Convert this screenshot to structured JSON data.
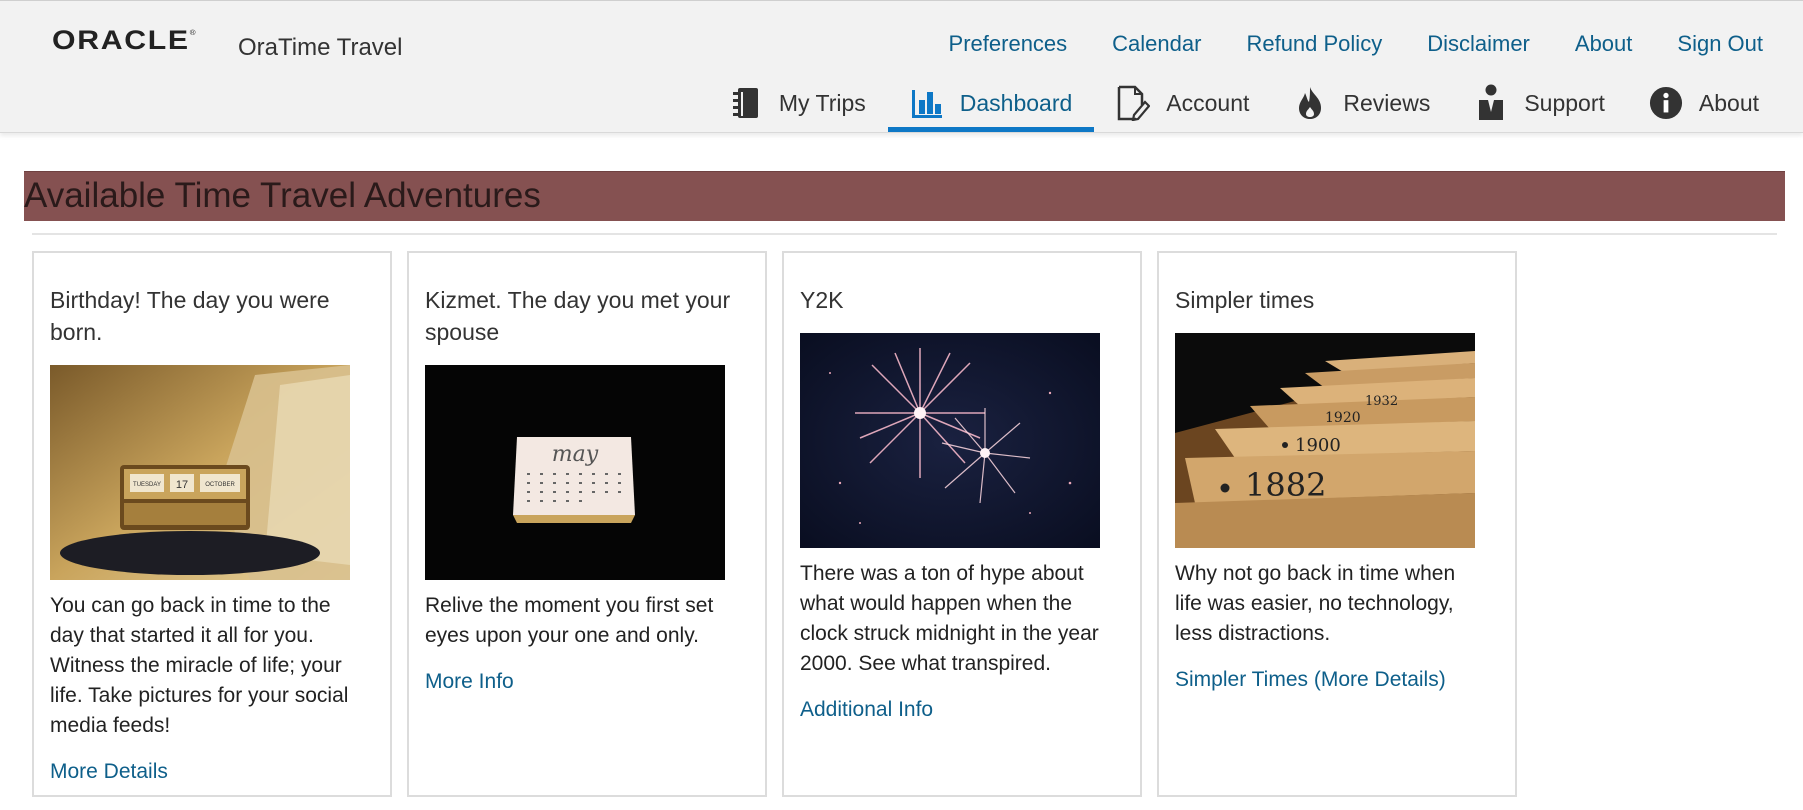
{
  "brand": {
    "logo_text": "ORACLE",
    "app_title": "OraTime Travel"
  },
  "top_links": [
    {
      "label": "Preferences"
    },
    {
      "label": "Calendar"
    },
    {
      "label": "Refund Policy"
    },
    {
      "label": "Disclaimer"
    },
    {
      "label": "About"
    },
    {
      "label": "Sign Out"
    }
  ],
  "nav_tabs": [
    {
      "label": "My Trips",
      "icon": "notebook-icon",
      "active": false
    },
    {
      "label": "Dashboard",
      "icon": "bar-chart-icon",
      "active": true
    },
    {
      "label": "Account",
      "icon": "edit-document-icon",
      "active": false
    },
    {
      "label": "Reviews",
      "icon": "flame-icon",
      "active": false
    },
    {
      "label": "Support",
      "icon": "person-icon",
      "active": false
    },
    {
      "label": "About",
      "icon": "info-icon",
      "active": false
    }
  ],
  "banner": {
    "title": "Available Time Travel Adventures"
  },
  "cards": [
    {
      "title": "Birthday! The day you were born.",
      "image": "calendar-block-photo",
      "description": "You can go back in time to the day that started it all for you. Witness the miracle of life; your life. Take pictures for your social media feeds!",
      "link": "More Details"
    },
    {
      "title": "Kizmet. The day you met your spouse",
      "image": "may-calendar-photo",
      "description": "Relive the moment you first set eyes upon your one and only.",
      "link": "More Info"
    },
    {
      "title": "Y2K",
      "image": "fireworks-photo",
      "description": "There was a ton of hype about what would happen when the clock struck midnight in the year 2000. See what transpired.",
      "link": "Additional Info"
    },
    {
      "title": "Simpler times",
      "image": "year-index-drawers-photo",
      "description": "Why not go back in time when life was easier, no technology, less distractions.",
      "link": "Simpler Times (More Details)"
    }
  ],
  "photo_labels": {
    "birthday_block": [
      "TUESDAY",
      "17",
      "OCTOBER"
    ],
    "may_calendar": "may",
    "drawer_years": [
      "1932",
      "1920",
      "1900",
      "1882"
    ]
  },
  "colors": {
    "link": "#0e5f8a",
    "active_tab_underline": "#0e78c6",
    "banner": "#855151",
    "header_bg": "#f2f2f2"
  }
}
